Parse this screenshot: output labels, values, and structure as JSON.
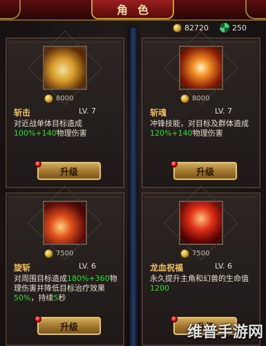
{
  "header": {
    "title": "角色"
  },
  "currency": {
    "gold": "82720",
    "gem": "250",
    "gold_icon": "gold-coin-icon",
    "gem_icon": "green-gem-icon"
  },
  "skills": [
    {
      "icon": "slash-skill-icon",
      "cost": "8000",
      "name": "斩击",
      "level": "LV. 7",
      "desc_parts": [
        "对近战单体目标造成",
        "100%+140",
        "物理伤害"
      ],
      "button": "升级"
    },
    {
      "icon": "soul-slash-skill-icon",
      "cost": "8000",
      "name": "斩魂",
      "level": "LV. 7",
      "desc_parts": [
        "冲锋技能，对目标及群体造成",
        "120%+140",
        "物理伤害"
      ],
      "button": "升级"
    },
    {
      "icon": "spin-slash-skill-icon",
      "cost": "7500",
      "name": "旋斩",
      "level": "LV. 6",
      "desc_parts": [
        "对周围目标造成",
        "180%+360",
        "物理伤害并降低目标治疗效果",
        "50%",
        "，持续",
        "5",
        "秒"
      ],
      "button": "升级"
    },
    {
      "icon": "dragon-blood-skill-icon",
      "cost": "7500",
      "name": "龙血祝福",
      "level": "LV. 6",
      "desc_parts": [
        "永久提升主角和幻兽的生命值",
        "1200"
      ],
      "button": "升级"
    }
  ],
  "watermark": "维普手游网"
}
